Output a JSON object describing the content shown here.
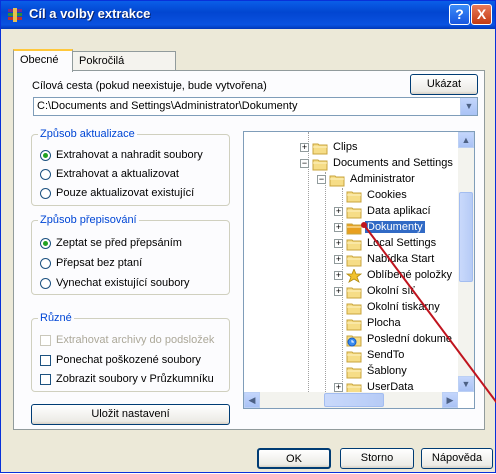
{
  "window": {
    "title": "Cíl a volby extrakce",
    "help_glyph": "?",
    "close_glyph": "X"
  },
  "tabs": [
    {
      "label": "Obecné",
      "active": true
    },
    {
      "label": "Pokročilá nastavení",
      "active": false
    }
  ],
  "path": {
    "label": "Cílová cesta (pokud neexistuje, bude vytvořena)",
    "show_button": "Ukázat",
    "value": "C:\\Documents and Settings\\Administrator\\Dokumenty"
  },
  "update_group": {
    "title": "Způsob aktualizace",
    "options": [
      {
        "label": "Extrahovat a nahradit soubory",
        "selected": true
      },
      {
        "label": "Extrahovat a aktualizovat",
        "selected": false
      },
      {
        "label": "Pouze aktualizovat existující",
        "selected": false
      }
    ]
  },
  "overwrite_group": {
    "title": "Způsob přepisování",
    "options": [
      {
        "label": "Zeptat se před přepsáním",
        "selected": true
      },
      {
        "label": "Přepsat bez ptaní",
        "selected": false
      },
      {
        "label": "Vynechat existující soubory",
        "selected": false
      }
    ]
  },
  "misc_group": {
    "title": "Různé",
    "options": [
      {
        "label": "Extrahovat archivy do podsložek",
        "checked": false,
        "enabled": false
      },
      {
        "label": "Ponechat poškozené soubory",
        "checked": false,
        "enabled": true
      },
      {
        "label": "Zobrazit soubory v Průzkumníku",
        "checked": false,
        "enabled": true
      }
    ]
  },
  "save_button": "Uložit nastavení",
  "tree": {
    "nodes": [
      {
        "label": "Clips",
        "expander": "+",
        "selected": false
      },
      {
        "label": "Documents and Settings",
        "expander": "−",
        "selected": false
      },
      {
        "label": "Administrator",
        "expander": "−",
        "selected": false
      },
      {
        "label": "Cookies",
        "expander": "",
        "selected": false
      },
      {
        "label": "Data aplikací",
        "expander": "+",
        "selected": false
      },
      {
        "label": "Dokumenty",
        "expander": "+",
        "selected": true
      },
      {
        "label": "Local Settings",
        "expander": "+",
        "selected": false
      },
      {
        "label": "Nabídka Start",
        "expander": "+",
        "selected": false
      },
      {
        "label": "Oblíbené položky",
        "expander": "+",
        "selected": false
      },
      {
        "label": "Okolní síť",
        "expander": "+",
        "selected": false
      },
      {
        "label": "Okolní tiskárny",
        "expander": "",
        "selected": false
      },
      {
        "label": "Plocha",
        "expander": "",
        "selected": false
      },
      {
        "label": "Poslední dokume",
        "expander": "",
        "selected": false
      },
      {
        "label": "SendTo",
        "expander": "",
        "selected": false
      },
      {
        "label": "Šablony",
        "expander": "",
        "selected": false
      },
      {
        "label": "UserData",
        "expander": "+",
        "selected": false
      },
      {
        "label": "WINDOWS",
        "expander": "+",
        "selected": false
      }
    ]
  },
  "buttons": {
    "ok": "OK",
    "cancel": "Storno",
    "help": "Nápověda"
  },
  "colors": {
    "title_bar": "#0246d1",
    "selection": "#316ac5",
    "group_title": "#0046d5",
    "annotation_line": "#c0141e"
  }
}
